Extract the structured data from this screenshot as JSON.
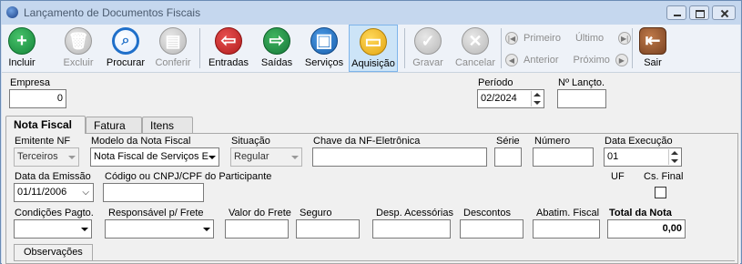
{
  "window": {
    "title": "Lançamento de Documentos Fiscais"
  },
  "toolbar": {
    "buttons": [
      {
        "label": "Incluir",
        "enabled": true,
        "icon": "plus-icon"
      },
      {
        "label": "Excluir",
        "enabled": false,
        "icon": "trash-icon"
      },
      {
        "label": "Procurar",
        "enabled": true,
        "icon": "magnifier-icon"
      },
      {
        "label": "Conferir",
        "enabled": false,
        "icon": "clipboard-icon"
      },
      {
        "label": "Entradas",
        "enabled": true,
        "icon": "doc-in-icon"
      },
      {
        "label": "Saídas",
        "enabled": true,
        "icon": "doc-out-icon"
      },
      {
        "label": "Serviços",
        "enabled": true,
        "icon": "toolbox-icon"
      },
      {
        "label": "Aquisição",
        "enabled": true,
        "icon": "briefcase-icon",
        "selected": true
      },
      {
        "label": "Gravar",
        "enabled": false,
        "icon": "check-icon"
      },
      {
        "label": "Cancelar",
        "enabled": false,
        "icon": "x-icon"
      }
    ],
    "nav": {
      "first": "Primeiro",
      "last": "Último",
      "prev": "Anterior",
      "next": "Próximo"
    },
    "exit_label": "Sair"
  },
  "header": {
    "empresa_label": "Empresa",
    "empresa_value": "0",
    "periodo_label": "Período",
    "periodo_value": "02/2024",
    "lancto_label": "Nº Lançto.",
    "lancto_value": ""
  },
  "tabs": [
    "Nota Fiscal",
    "Fatura",
    "Itens"
  ],
  "form": {
    "emitente_label": "Emitente NF",
    "emitente_value": "Terceiros",
    "modelo_label": "Modelo da Nota Fiscal",
    "modelo_value": "Nota Fiscal de Serviços E",
    "situacao_label": "Situação",
    "situacao_value": "Regular",
    "chave_label": "Chave da NF-Eletrônica",
    "chave_value": "",
    "serie_label": "Série",
    "serie_value": "",
    "numero_label": "Número",
    "numero_value": "",
    "data_exec_label": "Data Execução",
    "data_exec_value": "01",
    "data_emissao_label": "Data da Emissão",
    "data_emissao_value": "01/11/2006",
    "participante_label": "Código ou CNPJ/CPF do Participante",
    "participante_value": "",
    "uf_label": "UF",
    "csfinal_label": "Cs. Final",
    "cond_pagto_label": "Condições Pagto.",
    "resp_frete_label": "Responsável p/ Frete",
    "valor_frete_label": "Valor do Frete",
    "seguro_label": "Seguro",
    "desp_acess_label": "Desp. Acessórias",
    "descontos_label": "Descontos",
    "abatim_label": "Abatim. Fiscal",
    "total_label": "Total da Nota",
    "total_value": "0,00"
  },
  "subtab": {
    "label": "Observações"
  },
  "colors": {
    "annotation_arrow": "#e0202a",
    "selected_button_bg": "#cce4f7"
  }
}
